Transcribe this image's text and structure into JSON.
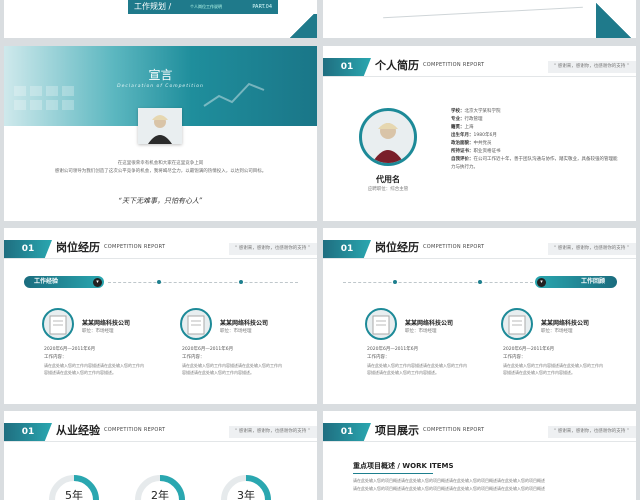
{
  "title_slide": {
    "heading": "工作规划 /",
    "small": "个人岗位工作说明",
    "part": "PART.04"
  },
  "slide1": {
    "title": "宣言",
    "subtitle": "Declaration of Competition",
    "paragraph_line1": "在这里很荣幸有机会和大家在这里竞争上岗",
    "paragraph_line2": "感谢公司领导为我们创造了这次公平竞争的机会，我将竭尽全力，以最饱满的热情投入，以达到公司目标。",
    "quote": "“天下无难事，只怕有心人”"
  },
  "slide2": {
    "num": "01",
    "title": "个人简历",
    "sub": "COMPETITION REPORT",
    "right": "“ 感谢来，感谢你，也感谢你的支持 ”",
    "name": "代用名",
    "position": "应聘职位：综合主管",
    "fields": [
      {
        "label": "学校：",
        "value": "北京大学某科学院"
      },
      {
        "label": "专业：",
        "value": "行政管理"
      },
      {
        "label": "籍贯：",
        "value": "上海"
      },
      {
        "label": "出生年月：",
        "value": "1980年6月"
      },
      {
        "label": "政治面貌：",
        "value": "中共党员"
      },
      {
        "label": "所持证书：",
        "value": "职业资格证书"
      },
      {
        "label": "自我评价：",
        "value": "在公司工作近十年，善于团队沟通与协作，踏实敬业，具备较强的管理能力与执行力。"
      }
    ]
  },
  "slide3": {
    "num": "01",
    "title": "岗位经历",
    "sub": "COMPETITION REPORT",
    "right": "“ 感谢来，感谢你，也感谢你的支持 ”",
    "tag": "工作经验",
    "companies": [
      {
        "name": "某某网络科技公司",
        "role": "职位：市场经理",
        "date": "2020年6月—2011年6月",
        "content_label": "工作内容：",
        "content": "请在此处输入您的工作内容描述请在此处输入您的工作内容描述请在此处输入您的工作内容描述。"
      },
      {
        "name": "某某网络科技公司",
        "role": "职位：市场经理",
        "date": "2020年6月—2011年6月",
        "content_label": "工作内容：",
        "content": "请在此处输入您的工作内容描述请在此处输入您的工作内容描述请在此处输入您的工作内容描述。"
      }
    ]
  },
  "slide4": {
    "num": "01",
    "title": "岗位经历",
    "sub": "COMPETITION REPORT",
    "right": "“ 感谢来，感谢你，也感谢你的支持 ”",
    "tag": "工作回顾",
    "companies": [
      {
        "name": "某某网络科技公司",
        "role": "职位：市场经理",
        "date": "2020年6月—2011年6月",
        "content_label": "工作内容：",
        "content": "请在此处输入您的工作内容描述请在此处输入您的工作内容描述请在此处输入您的工作内容描述。"
      },
      {
        "name": "某某网络科技公司",
        "role": "职位：市场经理",
        "date": "2020年6月—2011年6月",
        "content_label": "工作内容：",
        "content": "请在此处输入您的工作内容描述请在此处输入您的工作内容描述请在此处输入您的工作内容描述。"
      }
    ]
  },
  "slide5": {
    "num": "01",
    "title": "从业经验",
    "sub": "COMPETITION REPORT",
    "right": "“ 感谢来，感谢你，也感谢你的支持 ”",
    "rings": [
      {
        "label": "5年",
        "fraction": 0.6
      },
      {
        "label": "2年",
        "fraction": 0.35
      },
      {
        "label": "3年",
        "fraction": 0.45
      }
    ]
  },
  "slide6": {
    "num": "01",
    "title": "项目展示",
    "sub": "COMPETITION REPORT",
    "right": "“ 感谢来，感谢你，也感谢你的支持 ”",
    "section": "重点项目概述 / WORK ITEMS",
    "text1": "请在此处输入您的项目概述请在此处输入您的项目概述请在此处输入您的项目概述请在此处输入您的项目概述",
    "text2": "请在此处输入您的项目概述请在此处输入您的项目概述请在此处输入您的项目概述请在此处输入您的项目概述"
  },
  "colors": {
    "accent": "#1d7f8e",
    "accent_light": "#2aa7b0"
  }
}
